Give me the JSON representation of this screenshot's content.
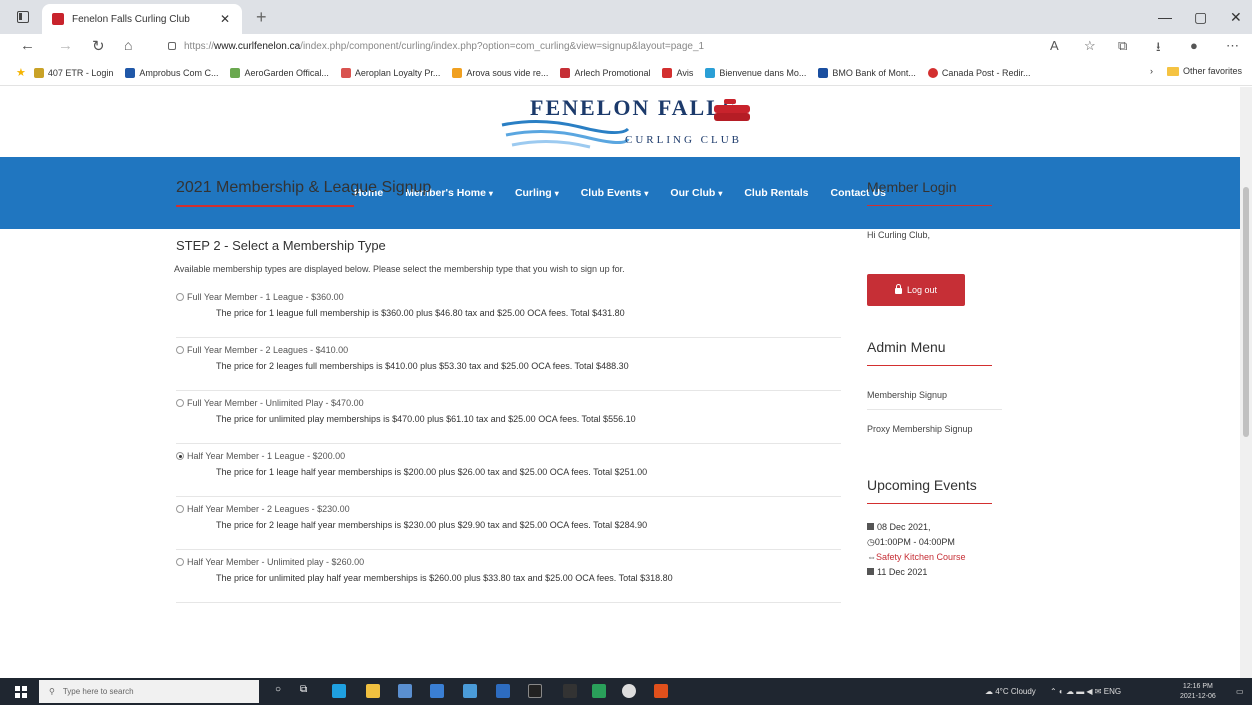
{
  "browser": {
    "tab_title": "Fenelon Falls Curling Club",
    "url_prefix": "https://",
    "url_host": "www.curlfenelon.ca",
    "url_path": "/index.php/component/curling/index.php?option=com_curling&view=signup&layout=page_1",
    "favorites": [
      {
        "label": "407 ETR - Login",
        "color": "#c9a227"
      },
      {
        "label": "Amprobus Com C...",
        "color": "#2058a8"
      },
      {
        "label": "AeroGarden Offical...",
        "color": "#6aa84f"
      },
      {
        "label": "Aeroplan Loyalty Pr...",
        "color": "#d9534f"
      },
      {
        "label": "Arova sous vide re...",
        "color": "#f0a020"
      },
      {
        "label": "Arlech Promotional",
        "color": "#c62f36"
      },
      {
        "label": "Avis",
        "color": "#d32f2f"
      },
      {
        "label": "Bienvenue dans Mo...",
        "color": "#2a9fd6"
      },
      {
        "label": "BMO Bank of Mont...",
        "color": "#1a4fa0"
      },
      {
        "label": "Canada Post - Redir...",
        "color": "#d32f2f"
      }
    ],
    "other_favorites": "Other favorites"
  },
  "site": {
    "logo_title": "FENELON FALLS",
    "logo_subtitle": "CURLING CLUB",
    "nav": [
      {
        "label": "Home",
        "dropdown": false
      },
      {
        "label": "Member's Home",
        "dropdown": true
      },
      {
        "label": "Curling",
        "dropdown": true
      },
      {
        "label": "Club Events",
        "dropdown": true
      },
      {
        "label": "Our Club",
        "dropdown": true
      },
      {
        "label": "Club Rentals",
        "dropdown": false
      },
      {
        "label": "Contact Us",
        "dropdown": false
      }
    ]
  },
  "main": {
    "title": "2021 Membership & League Signup",
    "step_title": "STEP 2 - Select a Membership Type",
    "step_desc": "Available membership types are displayed below. Please select the membership type that you wish to sign up for.",
    "options": [
      {
        "label": "Full Year Member - 1 League - $360.00",
        "desc": "The price for 1 league full membership is $360.00 plus $46.80 tax and $25.00 OCA fees. Total $431.80",
        "checked": false
      },
      {
        "label": "Full Year Member - 2 Leagues - $410.00",
        "desc": "The price for 2 leages full memberships is $410.00 plus $53.30 tax and $25.00 OCA fees. Total $488.30",
        "checked": false
      },
      {
        "label": "Full Year Member - Unlimited Play - $470.00",
        "desc": "The price for unlimited play memberships is $470.00 plus $61.10 tax and $25.00 OCA fees. Total $556.10",
        "checked": false
      },
      {
        "label": "Half Year Member - 1 League - $200.00",
        "desc": "The price for 1 leage half year memberships is $200.00 plus $26.00 tax and $25.00 OCA fees. Total $251.00",
        "checked": true
      },
      {
        "label": "Half Year Member - 2 Leagues - $230.00",
        "desc": "The price for 2 leage half year memberships is $230.00 plus $29.90 tax and $25.00 OCA fees. Total $284.90",
        "checked": false
      },
      {
        "label": "Half Year Member - Unlimited play - $260.00",
        "desc": "The price for unlimited play half year memberships is $260.00 plus $33.80 tax and $25.00 OCA fees. Total $318.80",
        "checked": false
      }
    ]
  },
  "sidebar": {
    "login_title": "Member Login",
    "greeting": "Hi Curling Club,",
    "logout_label": "Log out",
    "admin_title": "Admin Menu",
    "admin_links": [
      "Membership Signup",
      "Proxy Membership Signup"
    ],
    "events_title": "Upcoming Events",
    "event": {
      "date": "08 Dec 2021",
      "time": "01:00PM - 04:00PM",
      "name": "Safety Kitchen Course"
    },
    "next_event_date": "11 Dec 2021"
  },
  "taskbar": {
    "search_placeholder": "Type here to search",
    "weather": "4°C Cloudy",
    "time": "12:16 PM",
    "date": "2021-12-06"
  }
}
